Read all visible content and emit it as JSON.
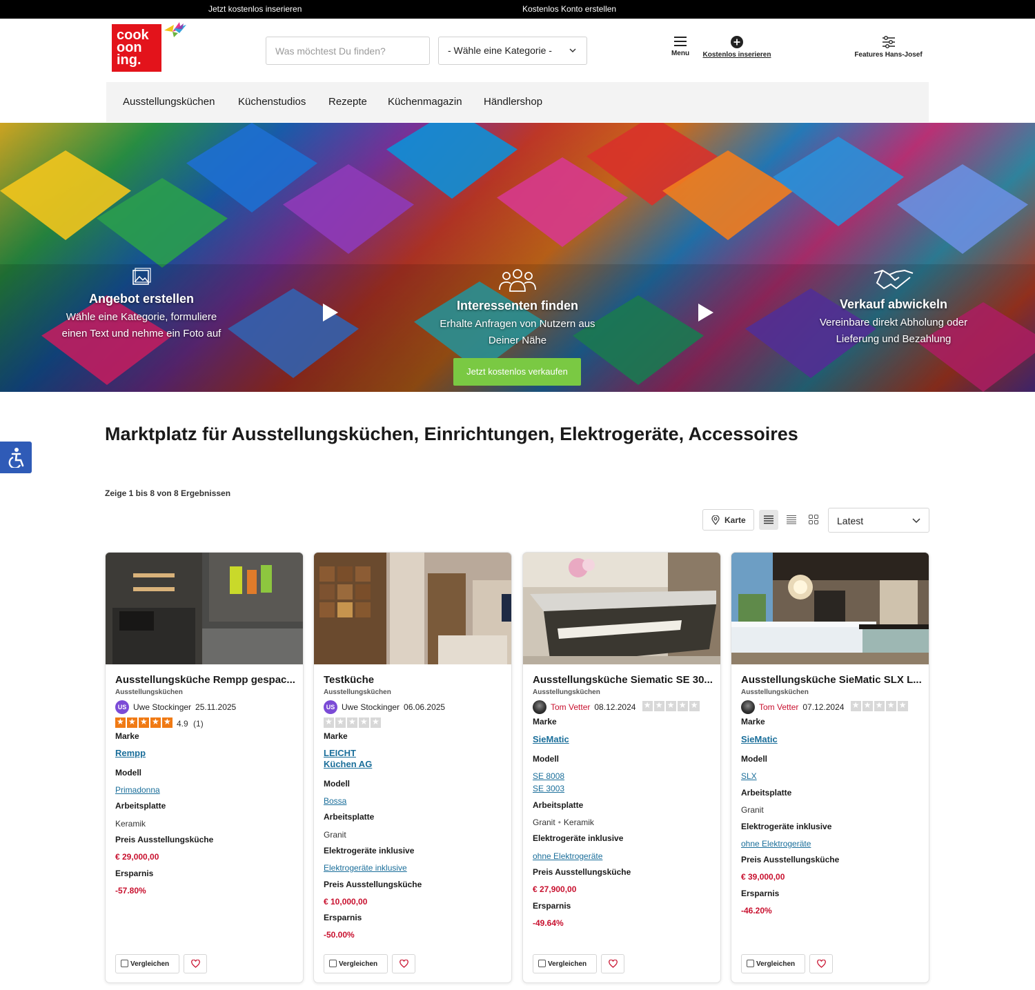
{
  "topbar": {
    "link1": "Jetzt kostenlos inserieren",
    "link2": "Kostenlos Konto erstellen"
  },
  "logo": {
    "line1": "cook",
    "line2": "oon",
    "line3": "ing."
  },
  "header": {
    "search_placeholder": "Was möchtest Du finden?",
    "category_select": "- Wähle eine Kategorie -",
    "menu_label": "Menu",
    "insert_label": "Kostenlos inserieren",
    "features_label": "Features Hans-Josef"
  },
  "nav": [
    "Ausstellungsküchen",
    "Küchenstudios",
    "Rezepte",
    "Küchenmagazin",
    "Händlershop"
  ],
  "hero": {
    "step1": {
      "title": "Angebot erstellen",
      "desc1": "Wähle eine Kategorie, formuliere",
      "desc2": "einen Text und nehme ein Foto auf"
    },
    "step2": {
      "title": "Interessenten finden",
      "desc1": "Erhalte Anfragen von Nutzern aus",
      "desc2": "Deiner Nähe"
    },
    "step3": {
      "title": "Verkauf abwickeln",
      "desc1": "Vereinbare direkt Abholung oder",
      "desc2": "Lieferung und Bezahlung"
    },
    "cta": "Jetzt kostenlos verkaufen"
  },
  "main": {
    "headline": "Marktplatz für Ausstellungsküchen, Einrichtungen, Elektrogeräte, Accessoires",
    "results": "Zeige 1 bis 8 von 8 Ergebnissen",
    "map_button": "Karte",
    "sort": "Latest"
  },
  "labels": {
    "brand": "Marke",
    "model": "Modell",
    "worktop": "Arbeitsplatte",
    "appliances": "Elektrogeräte inklusive",
    "price": "Preis Ausstellungsküche",
    "savings": "Ersparnis",
    "compare": "Vergleichen"
  },
  "cards": [
    {
      "title": "Ausstellungsküche Rempp gespac...",
      "category": "Ausstellungsküchen",
      "seller": {
        "initials": "US",
        "name": "Uwe Stockinger",
        "date": "25.11.2025"
      },
      "rating": {
        "stars": 5,
        "value": "4.9",
        "count": "(1)"
      },
      "brand": "Rempp",
      "model": "Primadonna",
      "worktop": "Keramik",
      "price": "€ 29,000,00",
      "savings": "-57.80%"
    },
    {
      "title": "Testküche",
      "category": "Ausstellungsküchen",
      "seller": {
        "initials": "US",
        "name": "Uwe Stockinger",
        "date": "06.06.2025"
      },
      "rating": {
        "stars": 0
      },
      "brand_line1": "LEICHT",
      "brand_line2": "Küchen AG",
      "model": "Bossa",
      "worktop": "Granit",
      "appliances": "Elektrogeräte inklusive",
      "price": "€ 10,000,00",
      "savings": "-50.00%"
    },
    {
      "title": "Ausstellungsküche Siematic SE 30...",
      "category": "Ausstellungsküchen",
      "seller": {
        "name": "Tom Vetter",
        "date": "08.12.2024"
      },
      "rating": {
        "stars": 0
      },
      "brand": "SieMatic",
      "model1": "SE 8008",
      "model2": "SE 3003",
      "worktop1": "Granit",
      "worktop2": "Keramik",
      "appliances": "ohne Elektrogeräte",
      "price": "€ 27,900,00",
      "savings": "-49.64%"
    },
    {
      "title": "Ausstellungsküche SieMatic SLX L...",
      "category": "Ausstellungsküchen",
      "seller": {
        "name": "Tom Vetter",
        "date": "07.12.2024"
      },
      "rating": {
        "stars": 0
      },
      "brand": "SieMatic",
      "model": "SLX",
      "worktop": "Granit",
      "appliances": "ohne Elektrogeräte",
      "price": "€ 39,000,00",
      "savings": "-46.20%"
    }
  ],
  "colors": {
    "brand_red": "#e3131b",
    "cta_green": "#7ac943",
    "price_red": "#c8102e",
    "link_blue": "#1a6e9a",
    "accessibility_blue": "#2f5bb7"
  }
}
